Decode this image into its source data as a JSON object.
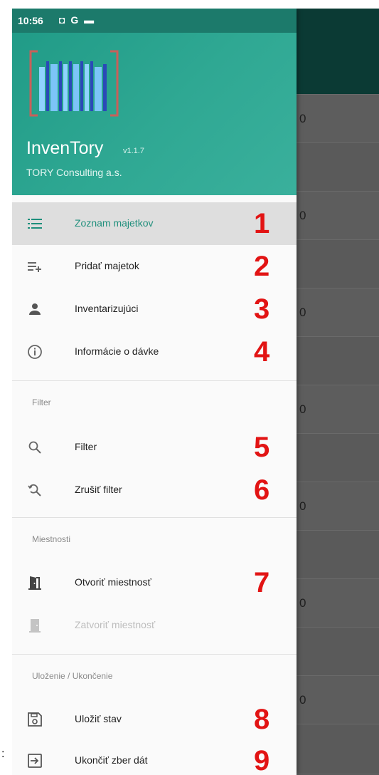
{
  "status_bar": {
    "time": "10:56",
    "icons": "◘ G ▬"
  },
  "drawer": {
    "app_name": "InvenTory",
    "version": "v1.1.7",
    "company": "TORY Consulting a.s.",
    "items": [
      {
        "label": "Zoznam majetkov",
        "number": "1",
        "icon": "list-icon",
        "active": true
      },
      {
        "label": "Pridať majetok",
        "number": "2",
        "icon": "playlist-add-icon"
      },
      {
        "label": "Inventarizujúci",
        "number": "3",
        "icon": "person-icon"
      },
      {
        "label": "Informácie o dávke",
        "number": "4",
        "icon": "info-icon"
      }
    ],
    "sections": [
      {
        "title": "Filter",
        "items": [
          {
            "label": "Filter",
            "number": "5",
            "icon": "search-icon"
          },
          {
            "label": "Zrušiť filter",
            "number": "6",
            "icon": "search-reset-icon"
          }
        ]
      },
      {
        "title": "Miestnosti",
        "items": [
          {
            "label": "Otvoriť miestnosť",
            "number": "7",
            "icon": "door-open-icon"
          },
          {
            "label": "Zatvoriť miestnosť",
            "number": "",
            "icon": "door-closed-icon",
            "disabled": true
          }
        ]
      },
      {
        "title": "Uloženie / Ukončenie",
        "items": [
          {
            "label": "Uložiť stav",
            "number": "8",
            "icon": "save-icon"
          },
          {
            "label": "Ukončiť zber dát",
            "number": "9",
            "icon": "exit-icon"
          }
        ]
      }
    ]
  },
  "background_rows": [
    "0",
    "0",
    "0",
    "0",
    "0",
    "0",
    "0"
  ],
  "colors": {
    "accent": "#1f9a86",
    "number_red": "#e21414"
  }
}
